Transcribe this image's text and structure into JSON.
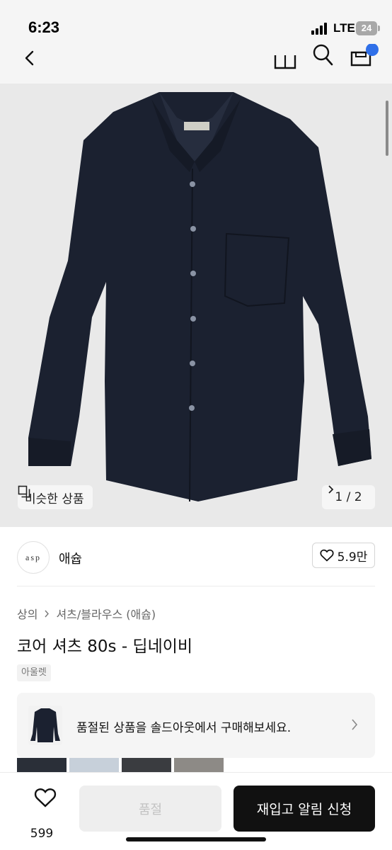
{
  "status_bar": {
    "time": "6:23",
    "network": "LTE",
    "battery": "24"
  },
  "nav": {
    "icons": [
      "back-icon",
      "book-icon",
      "search-icon",
      "cart-icon"
    ]
  },
  "gallery": {
    "similar_label": "비슷한 상품",
    "pager": "1 / 2",
    "current": 1,
    "total": 2
  },
  "shop": {
    "logo_text": "asp",
    "name": "애슙",
    "likes": "5.9만"
  },
  "breadcrumb": [
    "상의",
    "셔츠/블라우스 (애슙)"
  ],
  "product": {
    "title": "코어 셔츠 80s - 딥네이비",
    "badge": "아울렛"
  },
  "notice": {
    "text": "품절된 상품을 솔드아웃에서 구매해보세요."
  },
  "bottom_bar": {
    "favorite_count": "599",
    "soldout_label": "품절",
    "restock_label": "재입고 알림 신청"
  },
  "colors": {
    "accent": "#111111",
    "shirt": "#1b2130",
    "hero_bg": "#e9e9e9",
    "badge_blue": "#2f6fe8"
  }
}
